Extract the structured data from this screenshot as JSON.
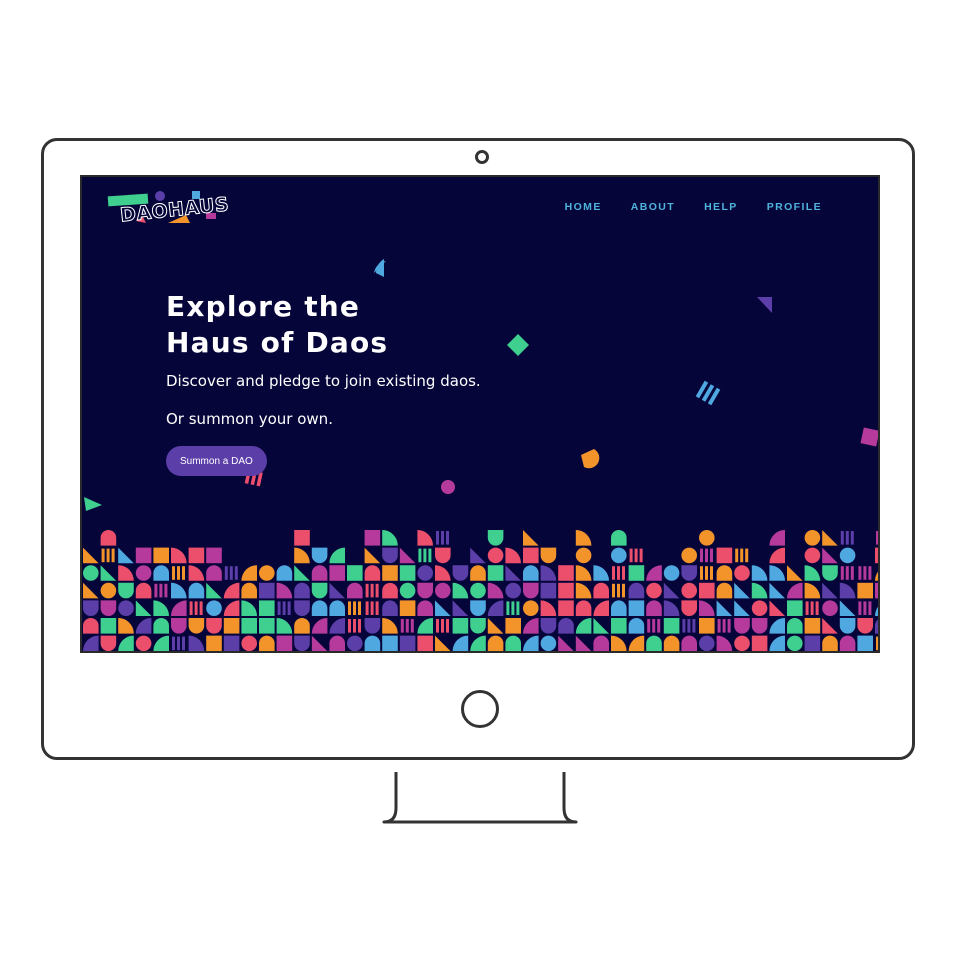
{
  "brand": {
    "logo_text": "DAOHAUS"
  },
  "nav": {
    "items": [
      "HOME",
      "ABOUT",
      "HELP",
      "PROFILE"
    ]
  },
  "hero": {
    "title_line1": "Explore the",
    "title_line2": "Haus of Daos",
    "subtitle": "Discover and pledge to join existing daos.",
    "subtitle2": "Or summon your own.",
    "cta_label": "Summon a DAO"
  },
  "colors": {
    "background": "#06053a",
    "nav_link": "#4fb4dc",
    "button": "#5b3ea8",
    "pattern": [
      "#f3942b",
      "#ec4f6b",
      "#3fcf8e",
      "#5b3ea8",
      "#4fa8e0",
      "#b63a9c"
    ]
  }
}
